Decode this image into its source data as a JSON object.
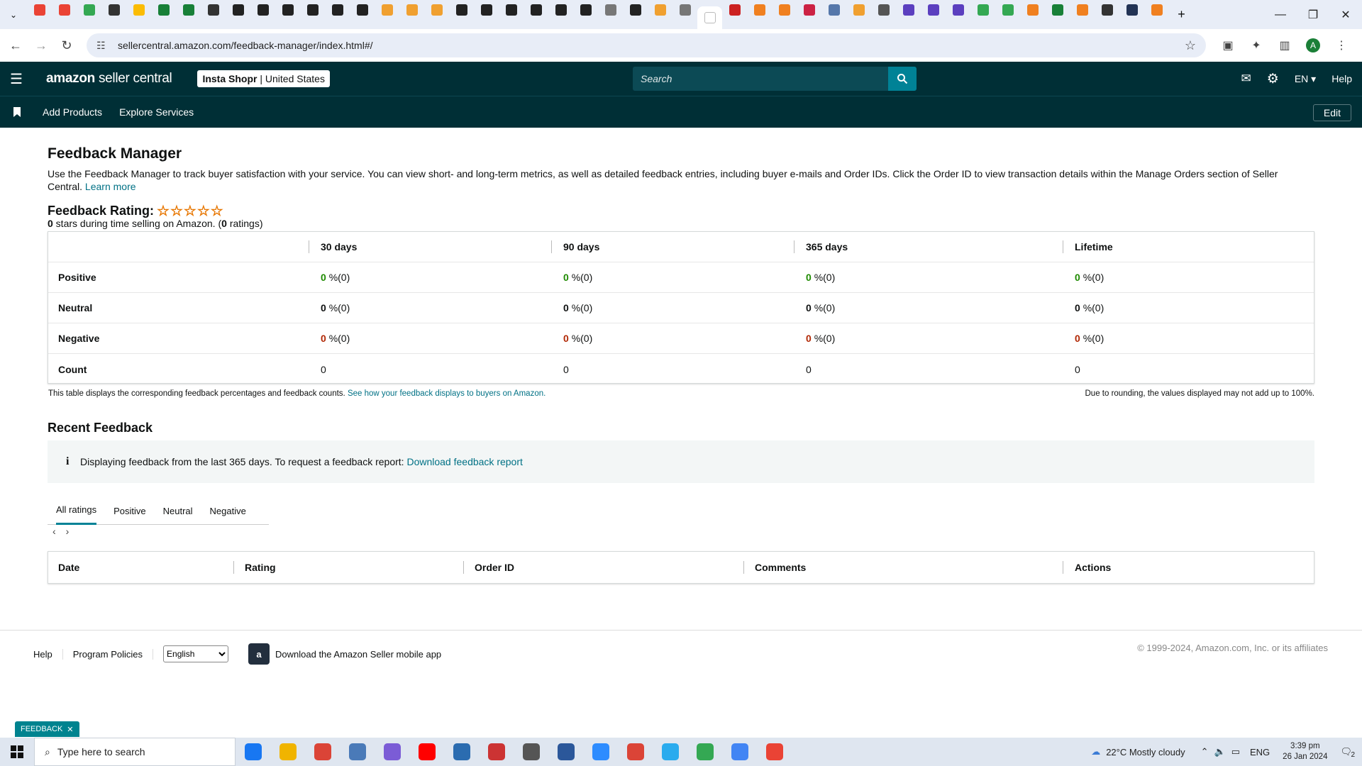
{
  "browser": {
    "url": "sellercentral.amazon.com/feedback-manager/index.html#/",
    "tab_colors": [
      "#ea4335",
      "#ea4335",
      "#34a853",
      "#333333",
      "#fbbc04",
      "#188038",
      "#188038",
      "#333333",
      "#222222",
      "#222222",
      "#222222",
      "#222222",
      "#222222",
      "#222222",
      "#f0a030",
      "#f0a030",
      "#f0a030",
      "#222222",
      "#222222",
      "#222222",
      "#222222",
      "#222222",
      "#222222",
      "#777777",
      "#222222",
      "#f0a030",
      "#777777",
      "#ffffff",
      "#cc2222",
      "#f08020",
      "#f08020",
      "#cc2244",
      "#5577aa",
      "#f0a030",
      "#555555",
      "#5b3fbf",
      "#5b3fbf",
      "#5b3fbf",
      "#34a853",
      "#34a853",
      "#f08020",
      "#188038",
      "#f08020",
      "#333333",
      "#223355",
      "#f08020"
    ],
    "avatar_letter": "A"
  },
  "header": {
    "logo_brand": "amazon",
    "logo_product": "seller central",
    "store_name": "Insta Shopr",
    "store_region": "United States",
    "search_placeholder": "Search",
    "lang": "EN",
    "help": "Help"
  },
  "nav": {
    "add_products": "Add Products",
    "explore_services": "Explore Services",
    "edit": "Edit"
  },
  "page": {
    "title": "Feedback Manager",
    "intro": "Use the Feedback Manager to track buyer satisfaction with your service. You can view short- and long-term metrics, as well as detailed feedback entries, including buyer e-mails and Order IDs. Click the Order ID to view transaction details within the Manage Orders section of Seller Central.",
    "learn_more": "Learn more",
    "rating_title": "Feedback Rating:",
    "stars_display": "☆☆☆☆☆",
    "stars_count": "0",
    "rating_sub_a": " stars during time selling on Amazon. (",
    "ratings_count": "0",
    "rating_sub_b": " ratings)"
  },
  "feedback_table": {
    "columns": [
      "30 days",
      "90 days",
      "365 days",
      "Lifetime"
    ],
    "rows": [
      {
        "label": "Positive",
        "values": [
          "0",
          "0",
          "0",
          "0"
        ],
        "suffix": "%(0)"
      },
      {
        "label": "Neutral",
        "values": [
          "0",
          "0",
          "0",
          "0"
        ],
        "suffix": "%(0)"
      },
      {
        "label": "Negative",
        "values": [
          "0",
          "0",
          "0",
          "0"
        ],
        "suffix": "%(0)"
      },
      {
        "label": "Count",
        "values": [
          "0",
          "0",
          "0",
          "0"
        ]
      }
    ],
    "note": "This table displays the corresponding feedback percentages and feedback counts.",
    "note_link": "See how your feedback displays to buyers on Amazon.",
    "rounding_note": "Due to rounding, the values displayed may not add up to 100%."
  },
  "recent": {
    "title": "Recent Feedback",
    "info_text": "Displaying feedback from the last 365 days. To request a feedback report:",
    "info_link": "Download feedback report",
    "tabs": [
      "All ratings",
      "Positive",
      "Neutral",
      "Negative"
    ],
    "columns": [
      "Date",
      "Rating",
      "Order ID",
      "Comments",
      "Actions"
    ]
  },
  "footer": {
    "help": "Help",
    "policies": "Program Policies",
    "language": "English",
    "app_text": "Download the Amazon Seller mobile app",
    "copyright": "© 1999-2024, Amazon.com, Inc. or its affiliates",
    "feedback_tab": "FEEDBACK"
  },
  "taskbar": {
    "search_placeholder": "Type here to search",
    "weather": "22°C  Mostly cloudy",
    "lang": "ENG",
    "time": "3:39 pm",
    "date": "26 Jan 2024",
    "notification_count": "2",
    "app_colors": [
      "#1877f2",
      "#f0b400",
      "#db4437",
      "#4a7ab8",
      "#7b5cd6",
      "#ff0000",
      "#2b6cb0",
      "#cc3333",
      "#555555",
      "#2b579a",
      "#2d8cff",
      "#db4437",
      "#2aabee",
      "#34a853",
      "#4285f4",
      "#ea4335"
    ]
  }
}
